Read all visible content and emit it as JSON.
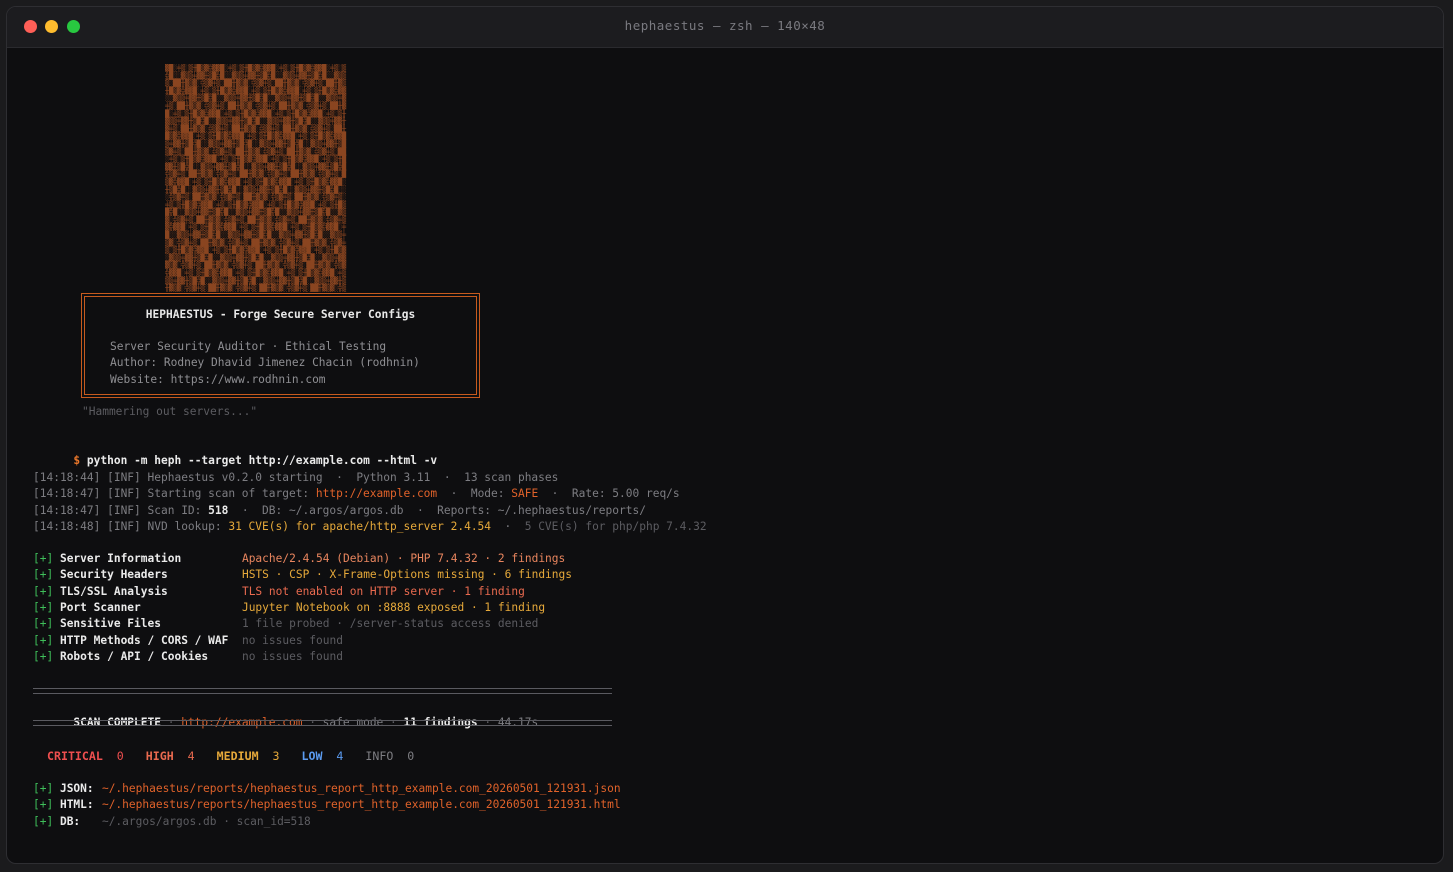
{
  "window": {
    "title": "hephaestus — zsh — 140×48"
  },
  "banner": {
    "title": "HEPHAESTUS - Forge Secure Server Configs",
    "line1": "Server Security Auditor · Ethical Testing",
    "line2": "Author: Rodney Dhavid Jimenez Chacin (rodhnin)",
    "line3": "Website: https://www.rodhnin.com"
  },
  "tagline": "\"Hammering out servers...\"",
  "command": {
    "prompt": "$",
    "text": "python -m heph --target http://example.com --html -v"
  },
  "logs": [
    {
      "time": "[14:18:44]",
      "level": "[INF]",
      "parts": [
        {
          "t": "Hephaestus v0.2.0 starting  ·  Python 3.11  ·  13 scan phases",
          "c": "gray"
        }
      ]
    },
    {
      "time": "[14:18:47]",
      "level": "[INF]",
      "parts": [
        {
          "t": "Starting scan of target: ",
          "c": "gray"
        },
        {
          "t": "http://example.com",
          "c": "orange"
        },
        {
          "t": "  ·  Mode: ",
          "c": "gray"
        },
        {
          "t": "SAFE",
          "c": "orange"
        },
        {
          "t": "  ·  Rate: 5.00 req/s",
          "c": "gray"
        }
      ]
    },
    {
      "time": "[14:18:47]",
      "level": "[INF]",
      "parts": [
        {
          "t": "Scan ID: ",
          "c": "gray"
        },
        {
          "t": "518",
          "c": "white bold"
        },
        {
          "t": "  ·  DB: ~/.argos/argos.db  ·  Reports: ~/.hephaestus/reports/",
          "c": "gray"
        }
      ]
    },
    {
      "time": "[14:18:48]",
      "level": "[INF]",
      "parts": [
        {
          "t": "NVD lookup: ",
          "c": "gray"
        },
        {
          "t": "31 CVE(s) for apache/http_server 2.4.54",
          "c": "amber"
        },
        {
          "t": "  ·  ",
          "c": "gray"
        },
        {
          "t": "5 CVE(s) for php/php 7.4.32",
          "c": "dim"
        }
      ]
    }
  ],
  "modules": [
    {
      "mark": "[+]",
      "name": "Server Information",
      "result": "Apache/2.4.54 (Debian) · PHP 7.4.32 · 2 findings",
      "c": "peach"
    },
    {
      "mark": "[+]",
      "name": "Security Headers",
      "result": "HSTS · CSP · X-Frame-Options missing · 6 findings",
      "c": "amber"
    },
    {
      "mark": "[+]",
      "name": "TLS/SSL Analysis",
      "result": "TLS not enabled on HTTP server · 1 finding",
      "c": "coral"
    },
    {
      "mark": "[+]",
      "name": "Port Scanner",
      "result": "Jupyter Notebook on :8888 exposed · 1 finding",
      "c": "amber"
    },
    {
      "mark": "[+]",
      "name": "Sensitive Files",
      "result": "1 file probed · /server-status access denied",
      "c": "dim"
    },
    {
      "mark": "[+]",
      "name": "HTTP Methods / CORS / WAF",
      "result": "no issues found",
      "c": "dim"
    },
    {
      "mark": "[+]",
      "name": "Robots / API / Cookies",
      "result": "no issues found",
      "c": "dim"
    }
  ],
  "summary": {
    "label": "SCAN COMPLETE",
    "sep": " · ",
    "target": "http://example.com",
    "mode": "safe mode",
    "findings": "11 findings",
    "duration": "44.17s"
  },
  "severity": [
    {
      "label": "CRITICAL",
      "count": "0",
      "c": "red"
    },
    {
      "label": "HIGH",
      "count": "4",
      "c": "coral"
    },
    {
      "label": "MEDIUM",
      "count": "3",
      "c": "amber"
    },
    {
      "label": "LOW",
      "count": "4",
      "c": "blue"
    },
    {
      "label": "INFO",
      "count": "0",
      "c": "gray"
    }
  ],
  "outputs": [
    {
      "mark": "[+]",
      "label": "JSON:",
      "value": "~/.hephaestus/reports/hephaestus_report_http_example.com_20260501_121931.json",
      "c": "orange"
    },
    {
      "mark": "[+]",
      "label": "HTML:",
      "value": "~/.hephaestus/reports/hephaestus_report_http_example.com_20260501_121931.html",
      "c": "orange"
    },
    {
      "mark": "[+]",
      "label": "DB:",
      "value": "~/.argos/argos.db · scan_id=518",
      "c": "dim"
    }
  ]
}
